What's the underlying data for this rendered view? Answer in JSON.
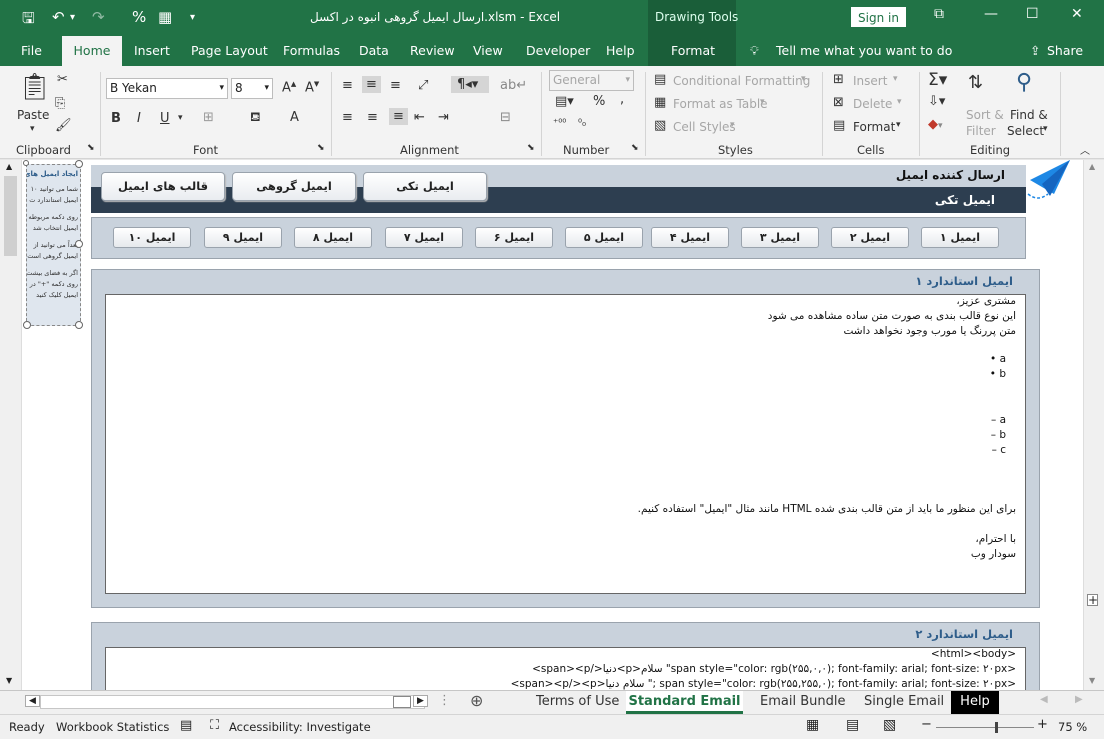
{
  "window": {
    "title": "ارسال ایمیل گروهی انبوه در اکسل.xlsm  -  Excel",
    "drawing_tools": "Drawing Tools",
    "sign_in": "Sign in"
  },
  "tabs": [
    "File",
    "Home",
    "Insert",
    "Page Layout",
    "Formulas",
    "Data",
    "Review",
    "View",
    "Developer",
    "Help",
    "Format"
  ],
  "tell_me": "Tell me what you want to do",
  "share": "Share",
  "ribbon": {
    "clipboard": {
      "label": "Clipboard",
      "paste": "Paste"
    },
    "font": {
      "label": "Font",
      "name": "B Yekan",
      "size": "8",
      "bold": "B",
      "italic": "I",
      "underline": "U"
    },
    "alignment": {
      "label": "Alignment"
    },
    "number": {
      "label": "Number",
      "format": "General",
      "percent": "%",
      "comma": ","
    },
    "styles": {
      "label": "Styles",
      "conditional": "Conditional Formatting",
      "format_table": "Format as Table",
      "cell_styles": "Cell Styles"
    },
    "cells": {
      "label": "Cells",
      "insert": "Insert",
      "delete": "Delete",
      "format": "Format"
    },
    "editing": {
      "label": "Editing",
      "sort": "Sort &",
      "filter": "Filter",
      "find": "Find &",
      "select": "Select"
    }
  },
  "side_panel": {
    "title": "ایجاد ایمیل های ل",
    "lines": [
      "شما می توانید ۱۰",
      "ایمیل استاندارد ت",
      "روی دکمه مربوطه",
      "ایمیل انتخاب شد",
      "بعداً می توانید از",
      "ایمیل گروهی است",
      "اگر به فضای بیشت",
      "روی دکمه \"+\" در",
      "ایمیل کلیک کنید"
    ]
  },
  "header": {
    "sender_title": "ارسال کننده ایمیل",
    "mode_title": "ایمیل تکی",
    "nav_buttons": [
      "ایمیل تکی",
      "ایمیل گروهی",
      "قالب های ایمیل"
    ]
  },
  "email_buttons": [
    "ایمیل ۱",
    "ایمیل ۲",
    "ایمیل ۳",
    "ایمیل ۴",
    "ایمیل ۵",
    "ایمیل ۶",
    "ایمیل ۷",
    "ایمیل ۸",
    "ایمیل ۹",
    "ایمیل ۱۰"
  ],
  "template1": {
    "title": "ایمیل استاندارد ۱",
    "lines": [
      "مشتری عزیز،",
      "این نوع قالب بندی به صورت متن ساده مشاهده می شود",
      "متن پررنگ یا مورب وجود نخواهد داشت",
      "",
      "a •",
      "b •",
      "",
      "",
      "a –",
      "b –",
      "c –",
      "",
      "",
      "",
      "",
      "برای این منظور ما باید از متن قالب بندی شده HTML مانند مثال \"ایمیل\" استفاده کنیم.",
      "",
      "با احترام،",
      "سودار وب"
    ]
  },
  "template2": {
    "title": "ایمیل استاندارد ۲",
    "lines": [
      "<html><body>",
      "<span><p/>دنیا<p>سلام \"span style=\"color: rgb(۲۵۵,۰,۰); font-family: arial; font-size: ۲۰px>",
      "<span><p/><p>سلام دنیا \"; span style=\"color: rgb(۲۵۵,۲۵۵,۰); font-family: arial; font-size: ۲۰px>"
    ]
  },
  "sheet_tabs": [
    "Terms of Use",
    "Standard Email",
    "Email Bundle",
    "Single Email",
    "Help"
  ],
  "active_sheet": "Standard Email",
  "status": {
    "ready": "Ready",
    "workbook_stats": "Workbook Statistics",
    "accessibility": "Accessibility: Investigate",
    "zoom": "75 %"
  },
  "colors": {
    "excel_green": "#217346",
    "panel_dark": "#2d3e50",
    "panel_light": "#c9d2dc",
    "title_blue": "#2e5d8a"
  }
}
